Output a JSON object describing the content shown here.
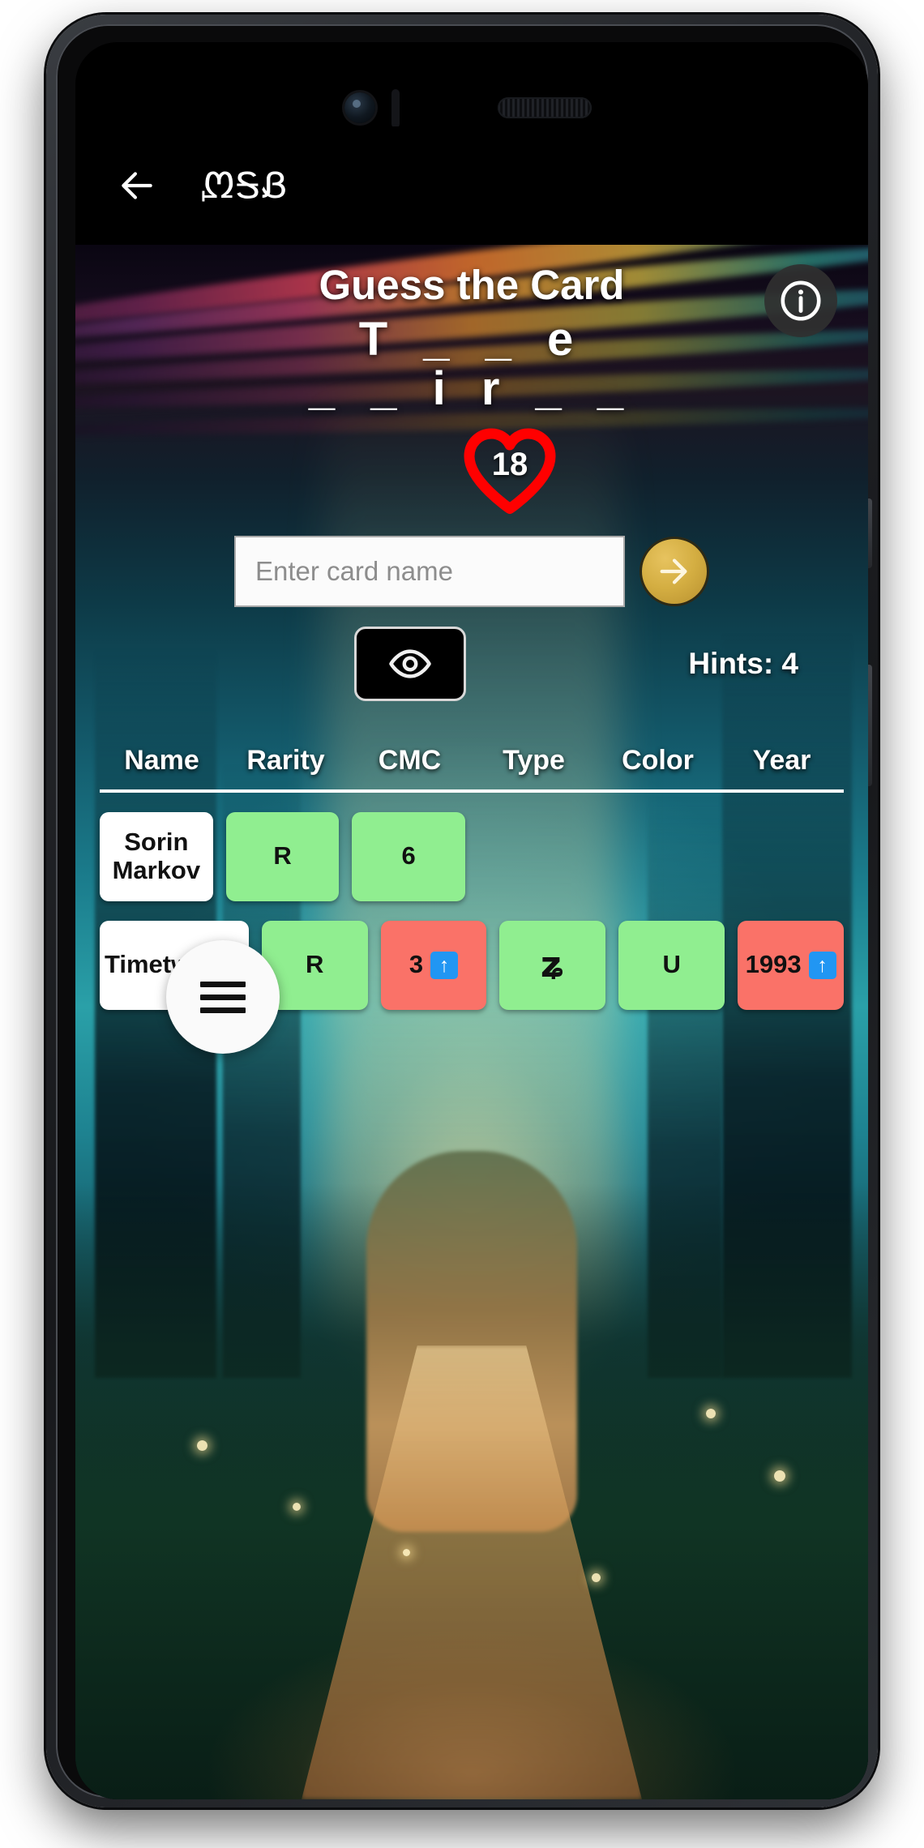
{
  "app": {
    "logo": "ᘻᎦᏰ",
    "back_icon": "arrow-left-icon"
  },
  "panel": {
    "title": "Guess the Card",
    "info_icon": "info-icon"
  },
  "puzzle": {
    "line1": "T _ _ e",
    "line2": "_ _ i r _ _"
  },
  "lives": {
    "count": "18",
    "icon": "heart-icon",
    "color": "#ff0000"
  },
  "guess": {
    "placeholder": "Enter card name",
    "value": "",
    "submit_icon": "arrow-right-icon"
  },
  "hints": {
    "reveal_icon": "eye-icon",
    "label": "Hints: 4"
  },
  "menu": {
    "icon": "hamburger-icon"
  },
  "table": {
    "columns": [
      "Name",
      "Rarity",
      "CMC",
      "Type",
      "Color",
      "Year"
    ],
    "rows": [
      {
        "cells": [
          {
            "text": "Sorin Markov",
            "state": "name"
          },
          {
            "text": "R",
            "state": "green"
          },
          {
            "text": "6",
            "state": "green"
          },
          {
            "text": "",
            "state": "empty"
          },
          {
            "text": "",
            "state": "empty"
          },
          {
            "text": "",
            "state": "empty"
          }
        ]
      },
      {
        "cells": [
          {
            "text": "Timetwister",
            "state": "name"
          },
          {
            "text": "R",
            "state": "green"
          },
          {
            "text": "3",
            "state": "red",
            "arrow": "↑"
          },
          {
            "text": "",
            "state": "green",
            "glyph": "sorcery-symbol"
          },
          {
            "text": "U",
            "state": "green"
          },
          {
            "text": "1993",
            "state": "red",
            "arrow": "↑"
          }
        ]
      }
    ]
  },
  "colors": {
    "correct": "#90ee90",
    "incorrect": "#fa7268",
    "accent_gold": "#d4ae42",
    "heart_red": "#ff0000"
  }
}
